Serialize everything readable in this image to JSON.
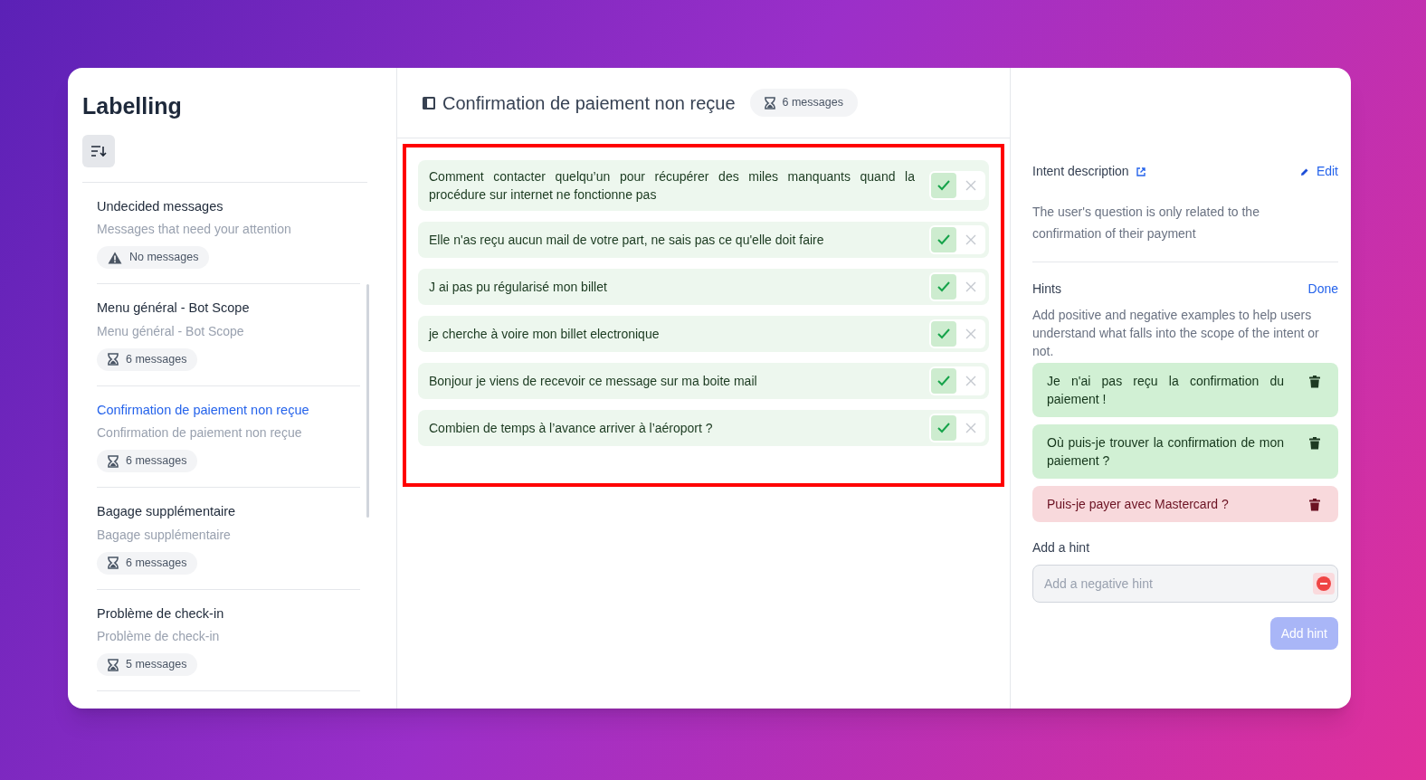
{
  "sidebar": {
    "title": "Labelling",
    "items": [
      {
        "title": "Undecided messages",
        "subtitle": "Messages that need your attention",
        "badge": "No messages",
        "kind": "warning",
        "selected": false
      },
      {
        "title": "Menu général - Bot Scope",
        "subtitle": "Menu général - Bot Scope",
        "badge": "6 messages",
        "kind": "pending",
        "selected": false
      },
      {
        "title": "Confirmation de paiement non reçue",
        "subtitle": "Confirmation de paiement non reçue",
        "badge": "6 messages",
        "kind": "pending",
        "selected": true
      },
      {
        "title": "Bagage supplémentaire",
        "subtitle": "Bagage supplémentaire",
        "badge": "6 messages",
        "kind": "pending",
        "selected": false
      },
      {
        "title": "Problème de check-in",
        "subtitle": "Problème de check-in",
        "badge": "5 messages",
        "kind": "pending",
        "selected": false
      }
    ]
  },
  "header": {
    "title": "Confirmation de paiement non reçue",
    "badge": "6 messages"
  },
  "messages": [
    {
      "text": "Comment contacter quelqu’un pour récupérer des miles manquants quand la procédure sur internet ne fonctionne pas",
      "accepted": true
    },
    {
      "text": "Elle n'as reçu aucun mail de votre part, ne sais pas ce qu'elle doit faire",
      "accepted": true
    },
    {
      "text": "J ai pas pu régularisé mon billet",
      "accepted": true
    },
    {
      "text": "je cherche à voire mon billet electronique",
      "accepted": true
    },
    {
      "text": "Bonjour je viens de recevoir ce message sur ma boite mail",
      "accepted": true
    },
    {
      "text": "Combien de temps à l’avance arriver à l’aéroport ?",
      "accepted": true
    }
  ],
  "intent": {
    "label": "Intent description",
    "edit": "Edit",
    "description": "The user's question is only related to the confirmation of their payment"
  },
  "hints": {
    "label": "Hints",
    "done": "Done",
    "help": "Add positive and negative examples to help users understand what falls into the scope of the intent or not.",
    "items": [
      {
        "text": "Je n'ai pas reçu la confirmation du paiement !",
        "kind": "positive"
      },
      {
        "text": "Où puis-je trouver la confirmation de mon paiement ?",
        "kind": "positive"
      },
      {
        "text": "Puis-je payer avec Mastercard ?",
        "kind": "negative"
      }
    ],
    "add_label": "Add a hint",
    "placeholder": "Add a negative hint",
    "negative_mode": true,
    "button": "Add hint",
    "button_disabled": true
  }
}
